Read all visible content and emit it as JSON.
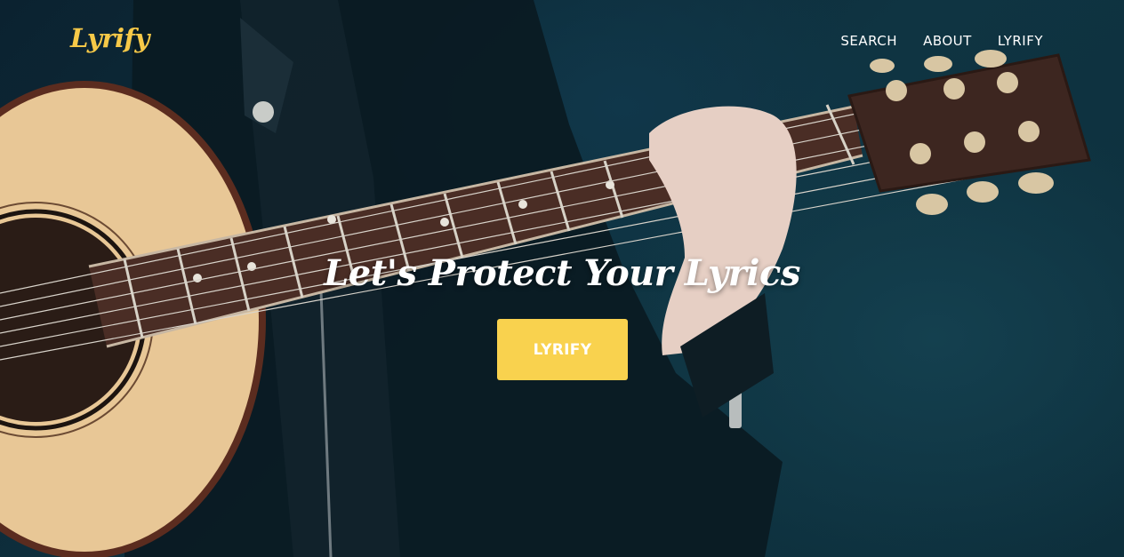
{
  "brand": {
    "logo": "Lyrify",
    "accent": "#f9d24e"
  },
  "nav": {
    "items": [
      {
        "label": "SEARCH"
      },
      {
        "label": "ABOUT"
      },
      {
        "label": "LYRIFY"
      }
    ]
  },
  "hero": {
    "headline": "Let's Protect Your Lyrics",
    "cta_label": "LYRIFY",
    "background_image": "guitar-player-photo"
  }
}
